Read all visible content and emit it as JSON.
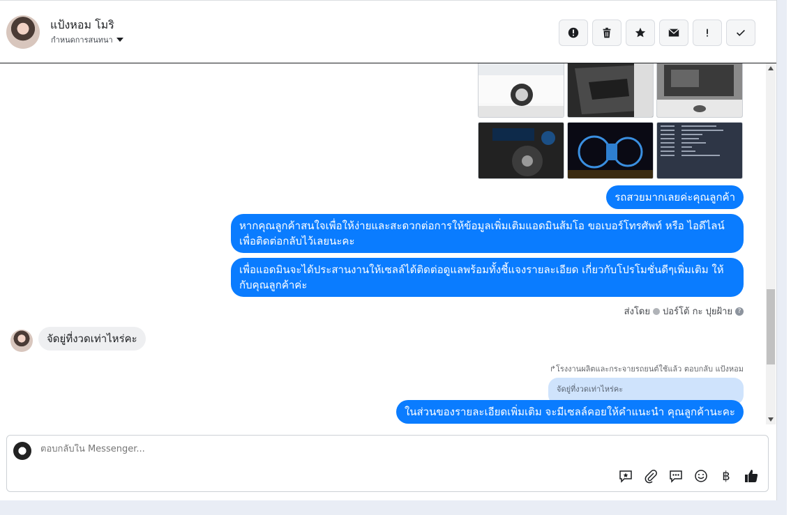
{
  "header": {
    "name": "แป้งหอม โมริ",
    "subtitle": "กำหนดการสนทนา",
    "actions": [
      "alert-circle-icon",
      "trash-icon",
      "star-icon",
      "envelope-icon",
      "exclamation-icon",
      "check-icon"
    ]
  },
  "messages": {
    "out1": "รถสวยมากเลยค่ะคุณลูกค้า",
    "out2": "หากคุณลูกค้าสนใจเพื่อให้ง่ายและสะดวกต่อการให้ข้อมูลเพิ่มเติมแอดมินส้มโอ ขอเบอร์โทรศัพท์ หรือ ไอดีไลน์เพื่อติดต่อกลับไว้เลยนะคะ",
    "out3": "เพื่อแอดมินจะได้ประสานงานให้เซลล์ได้ติดต่อดูแลพร้อมทั้งชี้แจงรายละเอียด เกี่ยวกับโปรโมชั่นดีๆเพิ่มเติม ให้กับคุณลูกค้าค่ะ",
    "sent_by_label": "ส่งโดย",
    "sent_by_name": "ปอร์โต้ กะ ปุยฝ้าย",
    "in1": "จัดยู่ที่งวดเท่าไหร่คะ",
    "reply_note": "↱โรงงานผลิตและกระจายรถยนต์ใช้แล้ว ตอบกลับ แป้งหอม",
    "quoted": "จัดยู่ที่งวดเท่าไหร่คะ",
    "out4": "ในส่วนของรายละเอียดเพิ่มเติม จะมีเซลล์คอยให้คำแนะนำ คุณลูกค้านะคะ"
  },
  "composer": {
    "placeholder": "ตอบกลับใน Messenger...",
    "currency": "฿"
  },
  "colors": {
    "outgoing": "#0a7cff",
    "incoming": "#eeeff1"
  }
}
